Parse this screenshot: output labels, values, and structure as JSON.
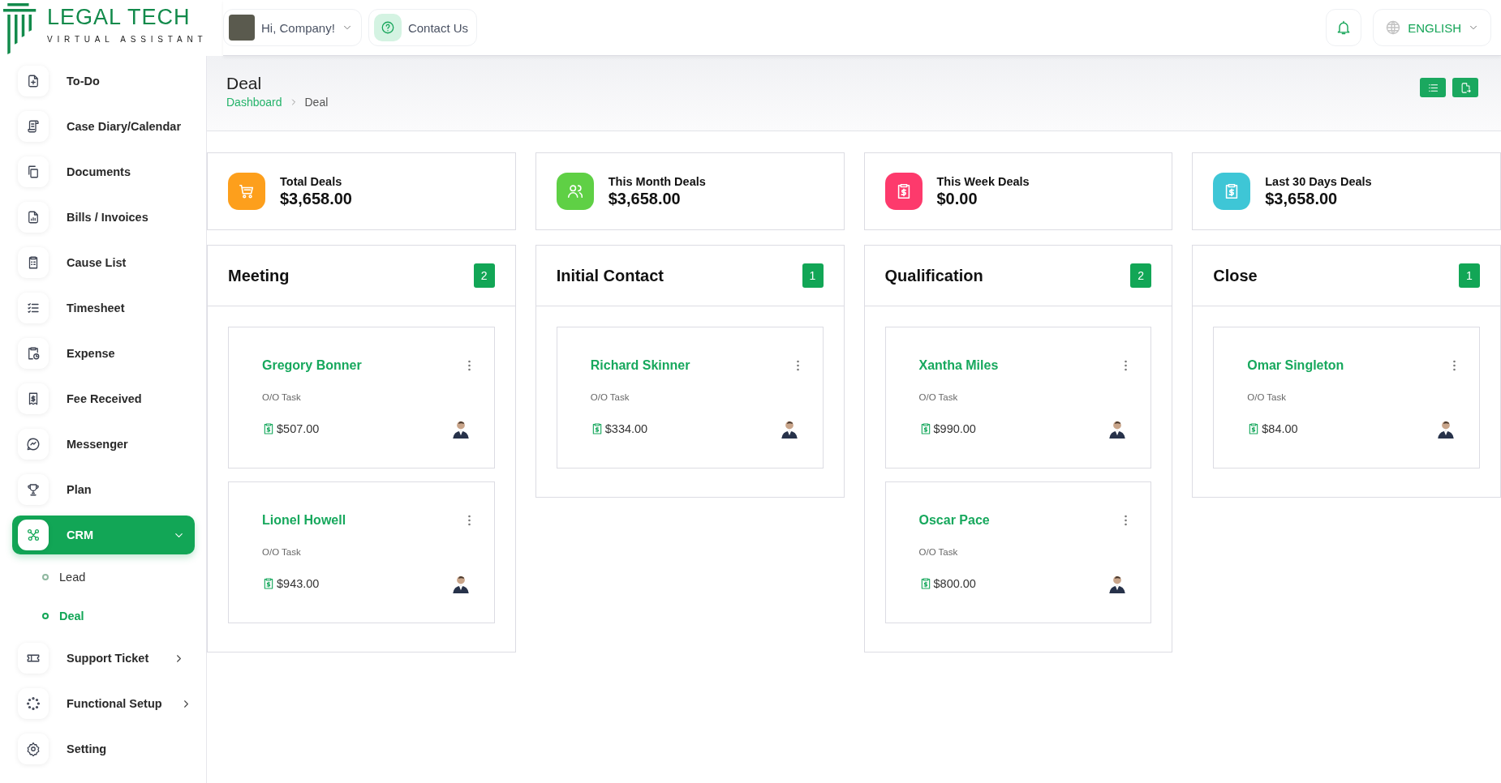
{
  "brand": {
    "name": "LEGAL TECH",
    "tagline": "VIRTUAL ASSISTANT"
  },
  "topbar": {
    "greeting": "Hi, Company!",
    "contact": "Contact Us",
    "language": "ENGLISH"
  },
  "sidebar": {
    "items": [
      {
        "label": "To-Do",
        "selected": false
      },
      {
        "label": "Case Diary/Calendar",
        "selected": false
      },
      {
        "label": "Documents",
        "selected": false
      },
      {
        "label": "Bills / Invoices",
        "selected": false
      },
      {
        "label": "Cause List",
        "selected": false
      },
      {
        "label": "Timesheet",
        "selected": false
      },
      {
        "label": "Expense",
        "selected": false
      },
      {
        "label": "Fee Received",
        "selected": false
      },
      {
        "label": "Messenger",
        "selected": false
      },
      {
        "label": "Plan",
        "selected": false
      },
      {
        "label": "CRM",
        "selected": true,
        "expanded": true,
        "children": [
          {
            "label": "Lead",
            "selected": false
          },
          {
            "label": "Deal",
            "selected": true
          }
        ]
      },
      {
        "label": "Support Ticket",
        "selected": false,
        "expanded": false
      },
      {
        "label": "Functional Setup",
        "selected": false,
        "expanded": false
      },
      {
        "label": "Setting",
        "selected": false
      }
    ]
  },
  "page": {
    "title": "Deal",
    "breadcrumb": [
      "Dashboard",
      "Deal"
    ]
  },
  "stats": [
    {
      "label": "Total Deals",
      "value": "$3,658.00",
      "color": "#fd9f1c"
    },
    {
      "label": "This Month Deals",
      "value": "$3,658.00",
      "color": "#5fd045"
    },
    {
      "label": "This Week Deals",
      "value": "$0.00",
      "color": "#fd3a6c"
    },
    {
      "label": "Last 30 Days Deals",
      "value": "$3,658.00",
      "color": "#3ec6d6"
    }
  ],
  "stages": [
    {
      "title": "Meeting",
      "count": "2",
      "deals": [
        {
          "name": "Gregory Bonner",
          "task": "O/O Task",
          "amount": "$507.00"
        },
        {
          "name": "Lionel Howell",
          "task": "O/O Task",
          "amount": "$943.00"
        }
      ]
    },
    {
      "title": "Initial Contact",
      "count": "1",
      "deals": [
        {
          "name": "Richard Skinner",
          "task": "O/O Task",
          "amount": "$334.00"
        }
      ]
    },
    {
      "title": "Qualification",
      "count": "2",
      "deals": [
        {
          "name": "Xantha Miles",
          "task": "O/O Task",
          "amount": "$990.00"
        },
        {
          "name": "Oscar Pace",
          "task": "O/O Task",
          "amount": "$800.00"
        }
      ]
    },
    {
      "title": "Close",
      "count": "1",
      "deals": [
        {
          "name": "Omar Singleton",
          "task": "O/O Task",
          "amount": "$84.00"
        }
      ]
    }
  ]
}
